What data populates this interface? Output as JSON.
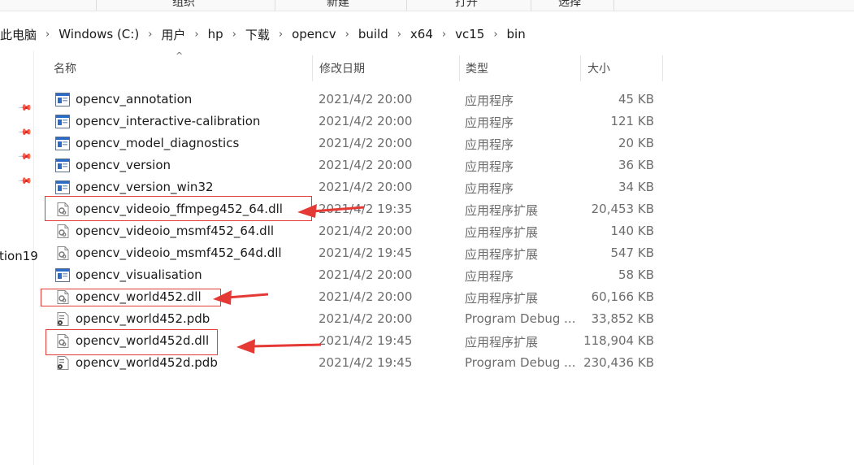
{
  "ribbon": {
    "groups": [
      "组织",
      "新建",
      "打开",
      "选择"
    ]
  },
  "address": {
    "crumbs": [
      "此电脑",
      "Windows (C:)",
      "用户",
      "hp",
      "下载",
      "opencv",
      "build",
      "x64",
      "vc15",
      "bin"
    ],
    "separator": "›"
  },
  "nav": {
    "partial_label": "tion19"
  },
  "columns": {
    "name": "名称",
    "date": "修改日期",
    "type": "类型",
    "size": "大小",
    "sort_indicator": "^"
  },
  "files": [
    {
      "name": "opencv_annotation",
      "date": "2021/4/2 20:00",
      "type": "应用程序",
      "size": "45 KB",
      "icon": "exe-icon"
    },
    {
      "name": "opencv_interactive-calibration",
      "date": "2021/4/2 20:00",
      "type": "应用程序",
      "size": "121 KB",
      "icon": "exe-icon"
    },
    {
      "name": "opencv_model_diagnostics",
      "date": "2021/4/2 20:00",
      "type": "应用程序",
      "size": "20 KB",
      "icon": "exe-icon"
    },
    {
      "name": "opencv_version",
      "date": "2021/4/2 20:00",
      "type": "应用程序",
      "size": "36 KB",
      "icon": "exe-icon"
    },
    {
      "name": "opencv_version_win32",
      "date": "2021/4/2 20:00",
      "type": "应用程序",
      "size": "34 KB",
      "icon": "exe-icon"
    },
    {
      "name": "opencv_videoio_ffmpeg452_64.dll",
      "date": "2021/4/2 19:35",
      "type": "应用程序扩展",
      "size": "20,453 KB",
      "icon": "dll-icon"
    },
    {
      "name": "opencv_videoio_msmf452_64.dll",
      "date": "2021/4/2 20:00",
      "type": "应用程序扩展",
      "size": "140 KB",
      "icon": "dll-icon"
    },
    {
      "name": "opencv_videoio_msmf452_64d.dll",
      "date": "2021/4/2 19:45",
      "type": "应用程序扩展",
      "size": "547 KB",
      "icon": "dll-icon"
    },
    {
      "name": "opencv_visualisation",
      "date": "2021/4/2 20:00",
      "type": "应用程序",
      "size": "58 KB",
      "icon": "exe-icon"
    },
    {
      "name": "opencv_world452.dll",
      "date": "2021/4/2 20:00",
      "type": "应用程序扩展",
      "size": "60,166 KB",
      "icon": "dll-icon"
    },
    {
      "name": "opencv_world452.pdb",
      "date": "2021/4/2 20:00",
      "type": "Program Debug ...",
      "size": "33,852 KB",
      "icon": "pdb-icon"
    },
    {
      "name": "opencv_world452d.dll",
      "date": "2021/4/2 19:45",
      "type": "应用程序扩展",
      "size": "118,904 KB",
      "icon": "dll-icon"
    },
    {
      "name": "opencv_world452d.pdb",
      "date": "2021/4/2 19:45",
      "type": "Program Debug ...",
      "size": "230,436 KB",
      "icon": "pdb-icon"
    }
  ],
  "annotations": {
    "color": "#e53935"
  }
}
